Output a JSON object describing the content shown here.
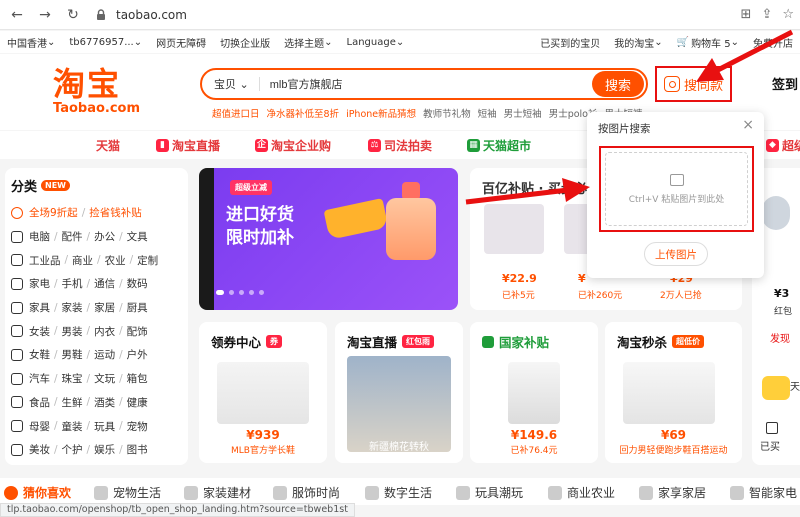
{
  "browser": {
    "url": "taobao.com"
  },
  "topnav": {
    "region": "中国香港",
    "user": "tb6776957...",
    "accessible": "网页无障碍",
    "switch_enterprise": "切换企业版",
    "theme": "选择主题",
    "language": "Language",
    "bought": "已买到的宝贝",
    "my_taobao": "我的淘宝",
    "cart": "购物车 5",
    "open_shop": "免费开店"
  },
  "header": {
    "logo_cn": "淘宝",
    "logo_en": "Taobao.com",
    "search_category": "宝贝",
    "search_query": "mlb官方旗舰店",
    "search_button": "搜索",
    "image_search_button": "搜同款",
    "login": "签到",
    "hotwords": [
      "超值进口日",
      "净水器补低至8折",
      "iPhone新品猜想",
      "教师节礼物",
      "短袖",
      "男士短袖",
      "男士polo衫",
      "男士短裤"
    ]
  },
  "channels": [
    "天猫",
    "淘宝直播",
    "淘宝企业购",
    "司法拍卖",
    "天猫超市",
    "超级"
  ],
  "sidebar": {
    "title": "分类",
    "new_badge": "NEW",
    "rows": [
      [
        "全场9折起",
        "捡省钱补贴"
      ],
      [
        "电脑",
        "配件",
        "办公",
        "文具"
      ],
      [
        "工业品",
        "商业",
        "农业",
        "定制"
      ],
      [
        "家电",
        "手机",
        "通信",
        "数码"
      ],
      [
        "家具",
        "家装",
        "家居",
        "厨具"
      ],
      [
        "女装",
        "男装",
        "内衣",
        "配饰"
      ],
      [
        "女鞋",
        "男鞋",
        "运动",
        "户外"
      ],
      [
        "汽车",
        "珠宝",
        "文玩",
        "箱包"
      ],
      [
        "食品",
        "生鲜",
        "酒类",
        "健康"
      ],
      [
        "母婴",
        "童装",
        "玩具",
        "宠物"
      ],
      [
        "美妆",
        "个护",
        "娱乐",
        "图书"
      ]
    ]
  },
  "banner": {
    "tag": "超级立减",
    "line1": "进口好货",
    "line2": "限时加补"
  },
  "subsidy": {
    "title": "百亿补贴 · 买贵必赔",
    "items": [
      {
        "price": "¥22.9",
        "note": "已补5元"
      },
      {
        "price": "¥",
        "note": "已补260元"
      },
      {
        "price": "¥29",
        "note": "2万人已抢"
      }
    ]
  },
  "cards": [
    {
      "title": "领券中心",
      "badge": "券",
      "price": "¥939",
      "sub": "MLB官方学长鞋"
    },
    {
      "title": "淘宝直播",
      "badge": "红包雨",
      "price": "",
      "sub": "新疆棉花转秋"
    },
    {
      "title": "国家补贴",
      "badge": "",
      "price": "¥149.6",
      "sub": "已补76.4元"
    },
    {
      "title": "淘宝秒杀",
      "badge": "超低价",
      "price": "¥69",
      "sub": "回力男轻便跑步鞋百搭运动"
    }
  ],
  "rightcol": {
    "price": "¥3",
    "label1": "红包",
    "label2": "发现",
    "label3": "天",
    "label4": "已买"
  },
  "popup": {
    "title": "按图片搜索",
    "drop_hint": "Ctrl+V 粘贴图片到此处",
    "upload_button": "上传图片"
  },
  "bottom_tabs": [
    "猜你喜欢",
    "宠物生活",
    "家装建材",
    "服饰时尚",
    "数字生活",
    "玩具潮玩",
    "商业农业",
    "家享家居",
    "智能家电"
  ],
  "status_url": "tlp.taobao.com/openshop/tb_open_shop_landing.htm?source=tbweb1st",
  "colors": {
    "accent": "#ff5000",
    "highlight": "#e81010"
  }
}
